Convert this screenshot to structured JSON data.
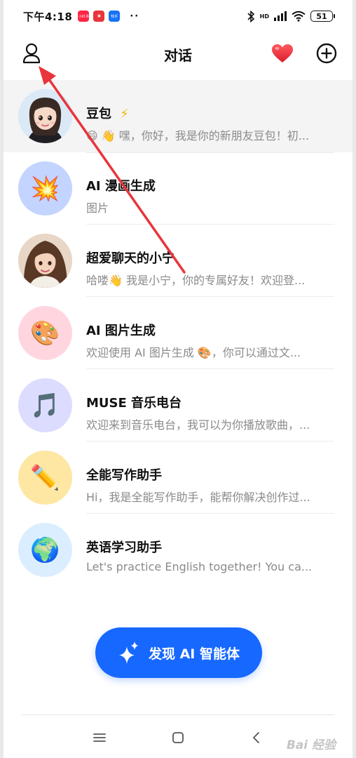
{
  "status_bar": {
    "time": "下午4:18",
    "apps": [
      {
        "name": "xiaohongshu-icon",
        "color": "#ff2442"
      },
      {
        "name": "tv-app-icon",
        "color": "#e8353b"
      },
      {
        "name": "zhihu-icon",
        "color": "#1772f6"
      }
    ],
    "more_dots": "··",
    "hd_label": "HD",
    "battery": "51"
  },
  "header": {
    "title": "对话",
    "heart_color": "#f23a45"
  },
  "chats": [
    {
      "name": "豆包",
      "name_suffix": "⚡",
      "preview": "😄 👋 嘿，你好，我是你的新朋友豆包！初...",
      "avatar_bg": "#dbe9f6",
      "avatar_glyph": "",
      "avatar_icon": "doubao-avatar"
    },
    {
      "name": "AI 漫画生成",
      "name_suffix": "",
      "preview": "图片",
      "avatar_bg": "#c3d4ff",
      "avatar_glyph": "💥",
      "avatar_icon": "explosion-icon"
    },
    {
      "name": "超爱聊天的小宁",
      "name_suffix": "",
      "preview": "哈喽👋 我是小宁，你的专属好友！欢迎登...",
      "avatar_bg": "#e8d7c6",
      "avatar_glyph": "",
      "avatar_icon": "xiaoning-avatar"
    },
    {
      "name": "AI 图片生成",
      "name_suffix": "",
      "preview": "欢迎使用 AI 图片生成 🎨，你可以通过文...",
      "avatar_bg": "#ffd6e0",
      "avatar_glyph": "🎨",
      "avatar_icon": "palette-icon"
    },
    {
      "name": "MUSE 音乐电台",
      "name_suffix": "",
      "preview": "欢迎来到音乐电台，我可以为你播放歌曲，...",
      "avatar_bg": "#dcdcff",
      "avatar_glyph": "🎵",
      "avatar_icon": "music-note-icon"
    },
    {
      "name": "全能写作助手",
      "name_suffix": "",
      "preview": "Hi，我是全能写作助手，能帮你解决创作过...",
      "avatar_bg": "#fde7a3",
      "avatar_glyph": "✏️",
      "avatar_icon": "pencil-icon"
    },
    {
      "name": "英语学习助手",
      "name_suffix": "",
      "preview": "Let's practice English together! You ca...",
      "avatar_bg": "#dbeeff",
      "avatar_glyph": "🌍",
      "avatar_icon": "globe-icon"
    }
  ],
  "discover_button": {
    "label": "发现 AI 智能体",
    "color": "#1668ff"
  },
  "watermark": "Bai 经验",
  "accent_red": "#e8353b"
}
